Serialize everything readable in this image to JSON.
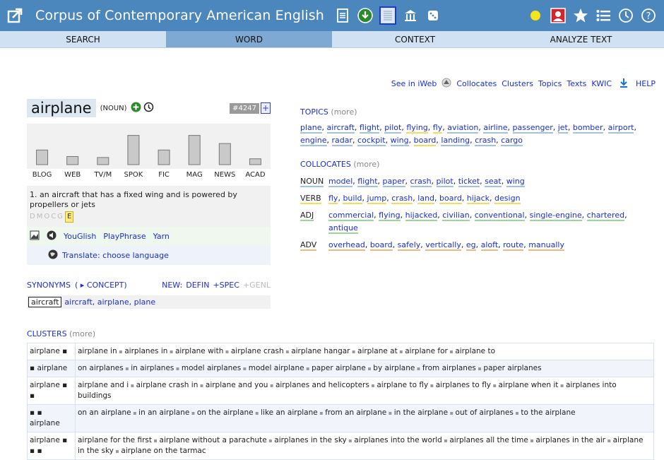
{
  "header": {
    "title": "Corpus of Contemporary American English",
    "colors": {
      "bar": "#4b86bd"
    }
  },
  "tabs": [
    {
      "label": "SEARCH"
    },
    {
      "label": "WORD"
    },
    {
      "label": "CONTEXT"
    },
    {
      "label": "ANALYZE TEXT"
    }
  ],
  "toplinks": {
    "see_iweb": "See in iWeb",
    "collocates": "Collocates",
    "clusters": "Clusters",
    "topics": "Topics",
    "texts": "Texts",
    "kwic": "KWIC",
    "help": "HELP"
  },
  "word": {
    "headword": "airplane",
    "pos": "(NOUN)",
    "rank": "#4247",
    "plus": "+"
  },
  "genre_chart": {
    "labels": [
      "BLOG",
      "WEB",
      "TV/M",
      "SPOK",
      "FIC",
      "MAG",
      "NEWS",
      "ACAD"
    ],
    "values": [
      0.45,
      0.25,
      0.22,
      0.9,
      0.45,
      0.9,
      0.65,
      0.18
    ]
  },
  "definition": {
    "text": "1. an aircraft that has a fixed wing and is powered by propellers or jets",
    "genres": "DMOCG",
    "badge": "E"
  },
  "media": {
    "youglish": "YouGlish",
    "playphrase": "PlayPhrase",
    "yarn": "Yarn",
    "translate": "Translate: choose language"
  },
  "synonyms": {
    "title": "SYNONYMS",
    "concept": "( ▸ CONCEPT)",
    "new": "NEW:",
    "defin": "DEFIN",
    "spec": "+SPEC",
    "genl": "+GENL",
    "chip": "aircraft",
    "list": "aircraft, airplane, plane"
  },
  "topics": {
    "title": "TOPICS",
    "more": "(more)",
    "items": [
      {
        "w": "plane",
        "c": "b"
      },
      {
        "w": "aircraft",
        "c": "b"
      },
      {
        "w": "flight",
        "c": "b"
      },
      {
        "w": "pilot",
        "c": "b"
      },
      {
        "w": "flying",
        "c": "y"
      },
      {
        "w": "fly",
        "c": "y"
      },
      {
        "w": "aviation",
        "c": "b"
      },
      {
        "w": "airline",
        "c": "b"
      },
      {
        "w": "passenger",
        "c": "b"
      },
      {
        "w": "jet",
        "c": "b"
      },
      {
        "w": "bomber",
        "c": "b"
      },
      {
        "w": "airport",
        "c": "b"
      },
      {
        "w": "engine",
        "c": "b"
      },
      {
        "w": "radar",
        "c": "b"
      },
      {
        "w": "cockpit",
        "c": "b"
      },
      {
        "w": "wing",
        "c": "b"
      },
      {
        "w": "board",
        "c": "y"
      },
      {
        "w": "landing",
        "c": "b"
      },
      {
        "w": "crash",
        "c": "b"
      },
      {
        "w": "cargo",
        "c": "b"
      }
    ]
  },
  "collocates": {
    "title": "COLLOCATES",
    "more": "(more)",
    "rows": [
      {
        "pos": "NOUN",
        "c": "b",
        "items": [
          "model",
          "flight",
          "paper",
          "crash",
          "pilot",
          "ticket",
          "seat",
          "wing"
        ]
      },
      {
        "pos": "VERB",
        "c": "y",
        "items": [
          "fly",
          "build",
          "jump",
          "crash",
          "land",
          "board",
          "hijack",
          "design"
        ]
      },
      {
        "pos": "ADJ",
        "c": "g",
        "items": [
          "commercial",
          "flying",
          "hijacked",
          "civilian",
          "conventional",
          "single-engine",
          "chartered",
          "antique"
        ]
      },
      {
        "pos": "ADV",
        "c": "o",
        "items": [
          "overhead",
          "board",
          "safely",
          "vertically",
          "eg",
          "aloft",
          "route",
          "manually"
        ]
      }
    ]
  },
  "clusters": {
    "title": "CLUSTERS",
    "more": "(more)",
    "rows": [
      {
        "key": "airplane ▪",
        "items": [
          "airplane in",
          "airplanes in",
          "airplane with",
          "airplane crash",
          "airplane hangar",
          "airplane at",
          "airplane for",
          "airplane to"
        ]
      },
      {
        "key": "▪ airplane",
        "items": [
          "on airplanes",
          "in airplanes",
          "model airplanes",
          "model airplane",
          "paper airplane",
          "by airplane",
          "from airplanes",
          "paper airplanes"
        ]
      },
      {
        "key": "airplane ▪ ▪",
        "items": [
          "airplane and i",
          "airplane crash in",
          "airplane and you",
          "airplanes and helicopters",
          "airplane to fly",
          "airplanes to fly",
          "airplane when it",
          "airplanes into buildings"
        ]
      },
      {
        "key": "▪ ▪ airplane",
        "items": [
          "on an airplane",
          "in an airplane",
          "on the airplane",
          "like an airplane",
          "from an airplane",
          "in the airplane",
          "out of airplanes",
          "to the airplane"
        ]
      },
      {
        "key": "airplane ▪ ▪ ▪",
        "items": [
          "airplane for the first",
          "airplane without a parachute",
          "airplanes in the sky",
          "airplanes into the world",
          "airplanes all the time",
          "airplanes in the air",
          "airplane in the sky",
          "airplane on the tarmac"
        ]
      }
    ]
  }
}
